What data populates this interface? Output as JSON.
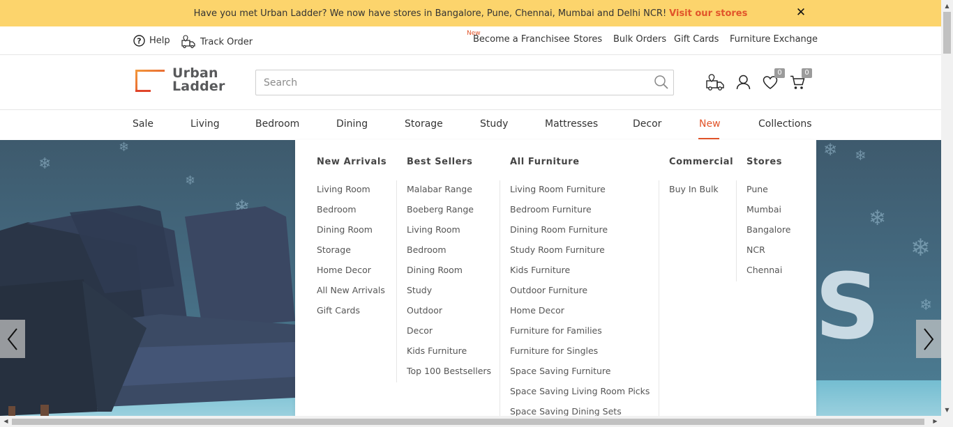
{
  "announcement": {
    "text": "Have you met Urban Ladder? We now have stores in Bangalore, Pune, Chennai, Mumbai and Delhi NCR!",
    "link": "Visit our stores",
    "close": "✕"
  },
  "utility": {
    "help": "Help",
    "track_order": "Track Order",
    "new_tag": "New",
    "links": [
      "Become a Franchisee",
      "Stores",
      "Bulk Orders",
      "Gift Cards",
      "Furniture Exchange"
    ]
  },
  "header": {
    "logo_line1": "Urban",
    "logo_line2": "Ladder",
    "search_placeholder": "Search",
    "wishlist_count": "0",
    "cart_count": "0"
  },
  "nav": {
    "items": [
      "Sale",
      "Living",
      "Bedroom",
      "Dining",
      "Storage",
      "Study",
      "Mattresses",
      "Decor",
      "New",
      "Collections"
    ],
    "active": "New"
  },
  "mega_menu": {
    "columns": [
      {
        "heading": "New Arrivals",
        "items": [
          "Living Room",
          "Bedroom",
          "Dining Room",
          "Storage",
          "Home Decor",
          "All New Arrivals",
          "Gift Cards"
        ]
      },
      {
        "heading": "Best Sellers",
        "items": [
          "Malabar Range",
          "Boeberg Range",
          "Living Room",
          "Bedroom",
          "Dining Room",
          "Study",
          "Outdoor",
          "Decor",
          "Kids Furniture",
          "Top 100 Bestsellers"
        ]
      },
      {
        "heading": "All Furniture",
        "items": [
          "Living Room Furniture",
          "Bedroom Furniture",
          "Dining Room Furniture",
          "Study Room Furniture",
          "Kids Furniture",
          "Outdoor Furniture",
          "Home Decor",
          "Furniture for Families",
          "Furniture for Singles",
          "Space Saving Furniture",
          "Space Saving Living Room Picks",
          "Space Saving Dining Sets"
        ]
      },
      {
        "heading": "Commercial",
        "items": [
          "Buy In Bulk"
        ]
      },
      {
        "heading": "Stores",
        "items": [
          "Pune",
          "Mumbai",
          "Bangalore",
          "NCR",
          "Chennai"
        ]
      }
    ]
  },
  "hero": {
    "prev_label": "‹",
    "next_label": "›"
  },
  "colors": {
    "accent": "#e1542a",
    "announcement_bg": "#fcd46c",
    "text": "#333333"
  }
}
